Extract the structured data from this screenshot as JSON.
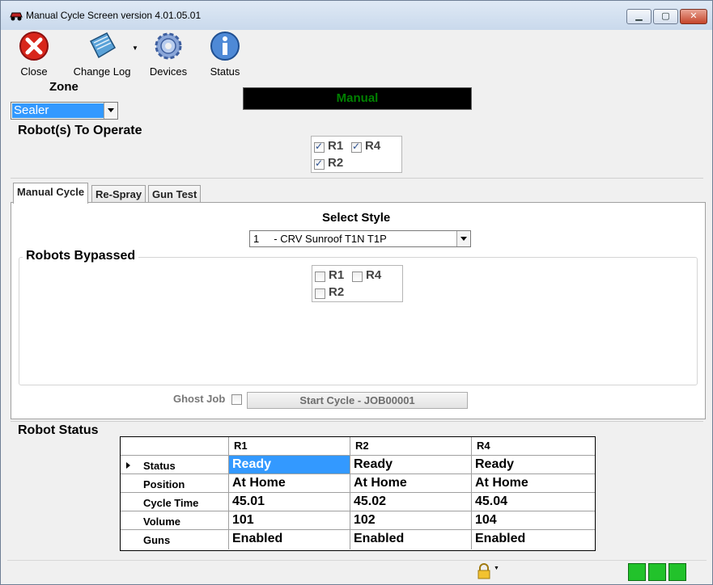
{
  "window": {
    "title": "Manual Cycle Screen  version  4.01.05.01"
  },
  "toolbar": {
    "close_label": "Close",
    "changelog_label": "Change Log",
    "devices_label": "Devices",
    "status_label": "Status"
  },
  "zone": {
    "label": "Zone",
    "selected": "Sealer"
  },
  "mode": {
    "text": "Manual",
    "color": "#008000"
  },
  "robots_to_operate": {
    "title": "Robot(s) To Operate",
    "items": [
      {
        "label": "R1",
        "checked": true
      },
      {
        "label": "R4",
        "checked": true
      },
      {
        "label": "R2",
        "checked": true
      }
    ]
  },
  "tabs": [
    {
      "label": "Manual Cycle",
      "active": true
    },
    {
      "label": "Re-Spray",
      "active": false
    },
    {
      "label": "Gun Test",
      "active": false
    }
  ],
  "manual_cycle": {
    "select_style_label": "Select Style",
    "selected_style": "1     - CRV Sunroof T1N T1P",
    "bypass_title": "Robots Bypassed",
    "bypass_items": [
      {
        "label": "R1",
        "checked": false
      },
      {
        "label": "R4",
        "checked": false
      },
      {
        "label": "R2",
        "checked": false
      }
    ],
    "ghost_job_label": "Ghost Job",
    "ghost_job_checked": false,
    "start_button": "Start Cycle - JOB00001"
  },
  "robot_status": {
    "title": "Robot Status",
    "columns": [
      "R1",
      "R2",
      "R4"
    ],
    "rows": [
      {
        "label": "Status",
        "values": [
          "Ready",
          "Ready",
          "Ready"
        ]
      },
      {
        "label": "Position",
        "values": [
          "At Home",
          "At Home",
          "At Home"
        ]
      },
      {
        "label": "Cycle Time",
        "values": [
          "45.01",
          "45.02",
          "45.04"
        ]
      },
      {
        "label": "Volume",
        "values": [
          "101",
          "102",
          "104"
        ]
      },
      {
        "label": "Guns",
        "values": [
          "Enabled",
          "Enabled",
          "Enabled"
        ]
      }
    ]
  },
  "statusbar": {
    "lock_icon": "lock-icon",
    "robot_icons": [
      "robot-icon",
      "robot-icon",
      "robot-icon"
    ],
    "robot_icon_color": "#22c22b"
  }
}
